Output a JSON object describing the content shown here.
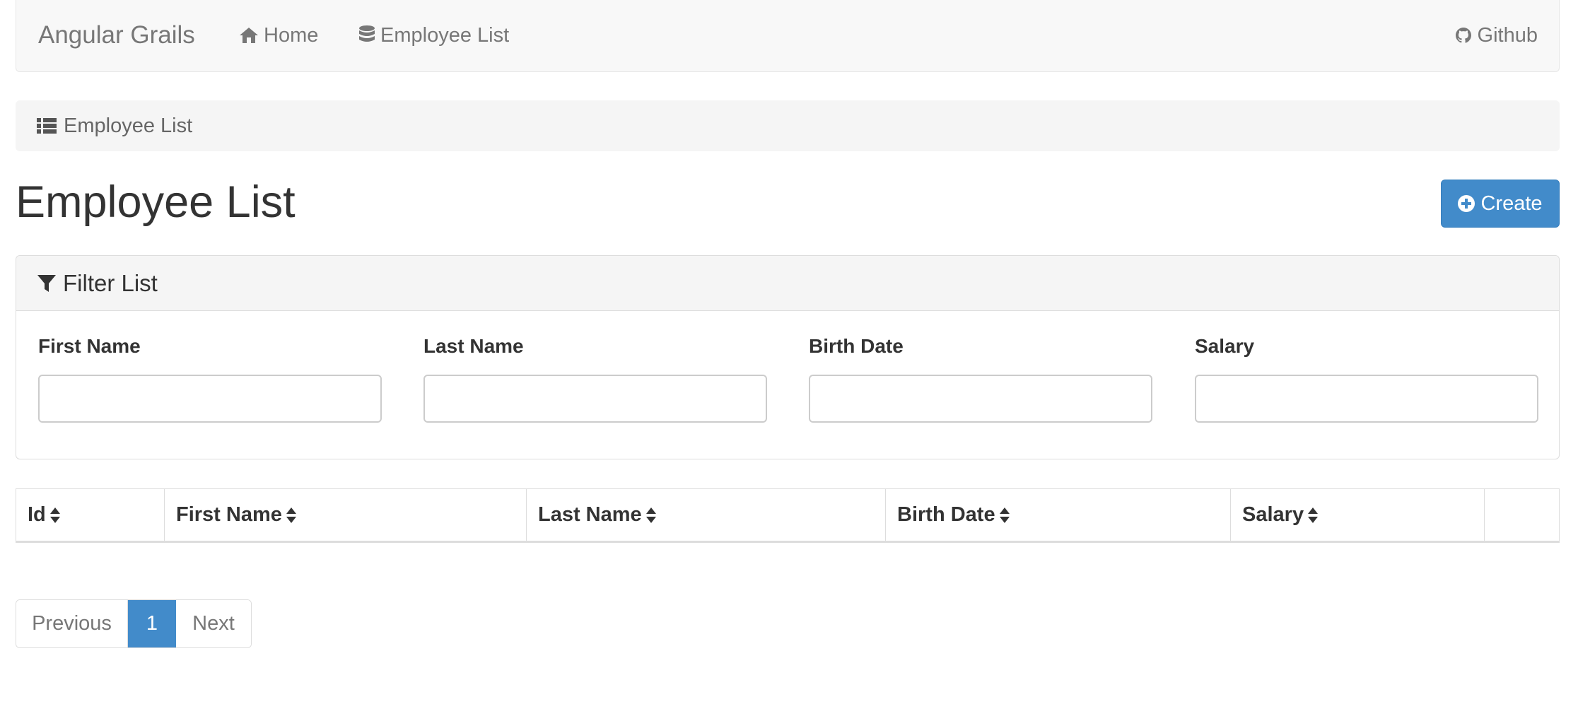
{
  "navbar": {
    "brand": "Angular Grails",
    "items": [
      {
        "label": "Home",
        "icon": "home-icon"
      },
      {
        "label": "Employee List",
        "icon": "database-icon"
      }
    ],
    "github": {
      "label": "Github",
      "icon": "github-icon"
    }
  },
  "breadcrumb": {
    "label": "Employee List",
    "icon": "list-icon"
  },
  "page": {
    "title": "Employee List"
  },
  "create_button": {
    "label": "Create",
    "icon": "plus-circle-icon"
  },
  "filter": {
    "heading": "Filter List",
    "icon": "filter-icon",
    "fields": [
      {
        "label": "First Name",
        "value": ""
      },
      {
        "label": "Last Name",
        "value": ""
      },
      {
        "label": "Birth Date",
        "value": ""
      },
      {
        "label": "Salary",
        "value": ""
      }
    ]
  },
  "table": {
    "columns": [
      "Id",
      "First Name",
      "Last Name",
      "Birth Date",
      "Salary",
      ""
    ],
    "rows": []
  },
  "pagination": {
    "previous": "Previous",
    "current": "1",
    "next": "Next"
  },
  "colors": {
    "primary": "#428bca",
    "navbar_bg": "#f8f8f8",
    "breadcrumb_bg": "#f5f5f5"
  }
}
